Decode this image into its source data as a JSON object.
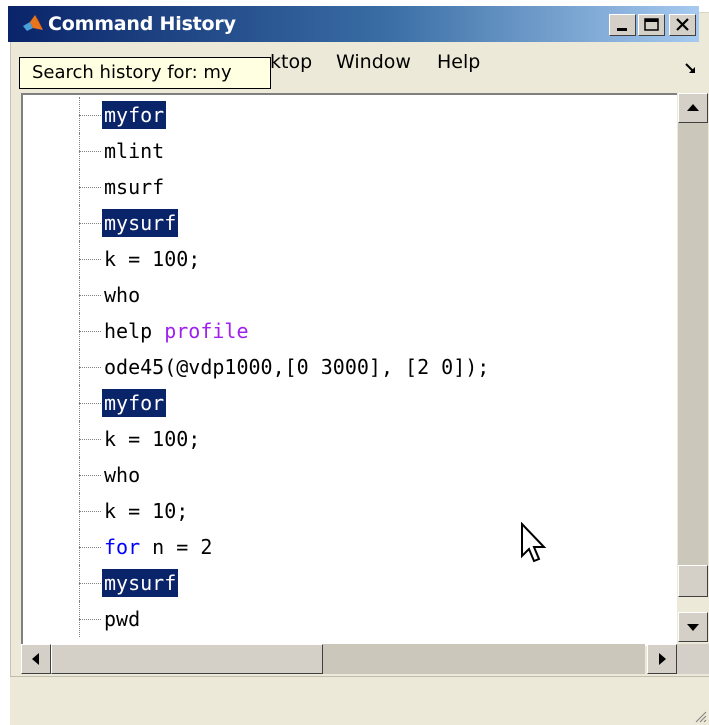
{
  "window": {
    "title": "Command History",
    "controls": [
      "minimize-icon",
      "maximize-icon",
      "close-icon"
    ]
  },
  "menubar": {
    "items": [
      {
        "label": "ktop"
      },
      {
        "label": "Window"
      },
      {
        "label": "Help"
      }
    ],
    "undock_icon": "undock-arrow-icon"
  },
  "tooltip": {
    "text": "Search history for: my"
  },
  "history": {
    "rows": [
      {
        "selected": true,
        "parts": [
          {
            "text": "myfor",
            "style": "plain"
          }
        ]
      },
      {
        "selected": false,
        "parts": [
          {
            "text": "mlint",
            "style": "plain"
          }
        ]
      },
      {
        "selected": false,
        "parts": [
          {
            "text": "msurf",
            "style": "plain"
          }
        ]
      },
      {
        "selected": true,
        "parts": [
          {
            "text": "mysurf",
            "style": "plain"
          }
        ]
      },
      {
        "selected": false,
        "parts": [
          {
            "text": "k = 100;",
            "style": "plain"
          }
        ]
      },
      {
        "selected": false,
        "parts": [
          {
            "text": "who",
            "style": "plain"
          }
        ]
      },
      {
        "selected": false,
        "parts": [
          {
            "text": "help ",
            "style": "plain"
          },
          {
            "text": "profile",
            "style": "str"
          }
        ]
      },
      {
        "selected": false,
        "parts": [
          {
            "text": "ode45(@vdp1000,[0 3000], [2 0]);",
            "style": "plain"
          }
        ]
      },
      {
        "selected": true,
        "parts": [
          {
            "text": "myfor",
            "style": "plain"
          }
        ]
      },
      {
        "selected": false,
        "parts": [
          {
            "text": "k = 100;",
            "style": "plain"
          }
        ]
      },
      {
        "selected": false,
        "parts": [
          {
            "text": "who",
            "style": "plain"
          }
        ]
      },
      {
        "selected": false,
        "parts": [
          {
            "text": "k = 10;",
            "style": "plain"
          }
        ]
      },
      {
        "selected": false,
        "parts": [
          {
            "text": "for",
            "style": "kw"
          },
          {
            "text": " n = 2",
            "style": "plain"
          }
        ]
      },
      {
        "selected": true,
        "parts": [
          {
            "text": "mysurf",
            "style": "plain"
          }
        ]
      },
      {
        "selected": false,
        "parts": [
          {
            "text": "pwd",
            "style": "plain"
          }
        ]
      }
    ]
  },
  "colors": {
    "selection_bg": "#0a246a",
    "keyword": "#0000ff",
    "string": "#a020f0",
    "titlebar_start": "#0a246a",
    "titlebar_end": "#a6caf0",
    "tooltip_bg": "#ffffe1"
  }
}
